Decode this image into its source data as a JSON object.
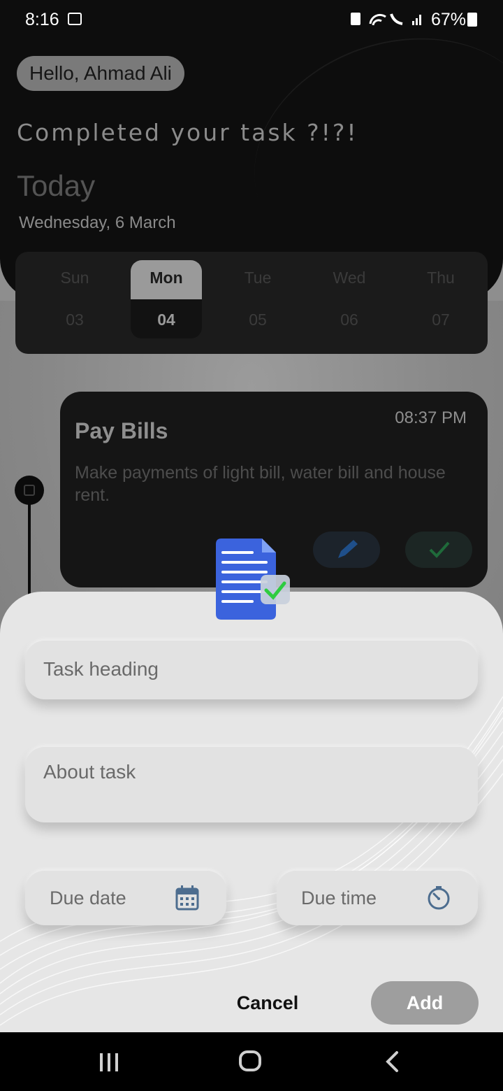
{
  "status_bar": {
    "time": "8:16",
    "battery_percent": "67%",
    "icons": [
      "gallery-notification-icon",
      "battery-saver-icon",
      "wifi-icon",
      "wifi-calling-icon",
      "signal-icon",
      "battery-icon"
    ]
  },
  "background_app": {
    "greeting": "Hello, Ahmad Ali",
    "headline": "Completed your task ?!?!",
    "today_label": "Today",
    "date_line": "Wednesday, 6 March",
    "week": [
      {
        "day": "Sun",
        "date": "03",
        "selected": false
      },
      {
        "day": "Mon",
        "date": "04",
        "selected": true
      },
      {
        "day": "Tue",
        "date": "05",
        "selected": false
      },
      {
        "day": "Wed",
        "date": "06",
        "selected": false
      },
      {
        "day": "Thu",
        "date": "07",
        "selected": false
      }
    ],
    "task_card": {
      "title": "Pay Bills",
      "time": "08:37 PM",
      "description": "Make payments of light bill, water bill and house rent."
    }
  },
  "add_task_sheet": {
    "heading_placeholder": "Task heading",
    "about_placeholder": "About task",
    "due_date_placeholder": "Due date",
    "due_time_placeholder": "Due time",
    "cancel_label": "Cancel",
    "add_label": "Add"
  },
  "colors": {
    "accent_doc_blue": "#3b63dd",
    "check_green": "#2ecc40",
    "field_icon": "#4d6d8f",
    "add_button": "#9e9e9e"
  }
}
